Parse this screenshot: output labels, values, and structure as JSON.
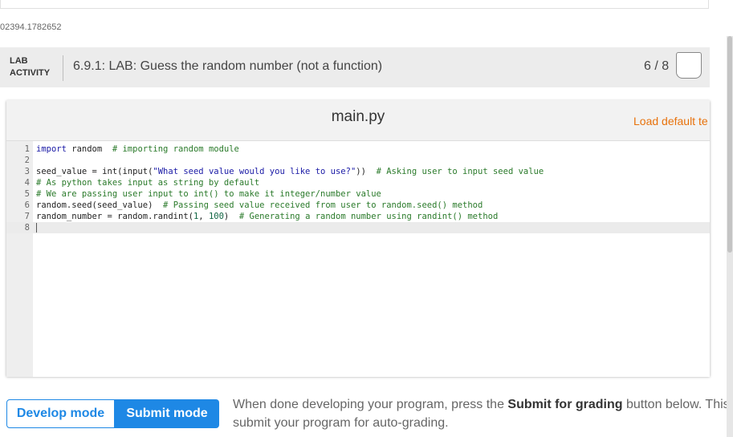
{
  "course_id": "02394.1782652",
  "lab": {
    "tag": "LAB\nACTIVITY",
    "title": "6.9.1: LAB: Guess the random number (not a function)",
    "score": "6 / 8"
  },
  "editor": {
    "filename": "main.py",
    "load_default": "Load default te",
    "lines": [
      {
        "n": "1",
        "parts": [
          {
            "t": "import",
            "c": "kw"
          },
          {
            "t": " random  ",
            "c": ""
          },
          {
            "t": "# importing random module",
            "c": "cm"
          }
        ]
      },
      {
        "n": "2",
        "parts": []
      },
      {
        "n": "3",
        "parts": [
          {
            "t": "seed_value = int(input(",
            "c": ""
          },
          {
            "t": "\"What seed value would you like to use?\"",
            "c": "str"
          },
          {
            "t": "))  ",
            "c": ""
          },
          {
            "t": "# Asking user to input seed value",
            "c": "cm"
          }
        ]
      },
      {
        "n": "4",
        "parts": [
          {
            "t": "# As python takes input as string by default",
            "c": "cm"
          }
        ]
      },
      {
        "n": "5",
        "parts": [
          {
            "t": "# We are passing user input to int() to make it integer/number value",
            "c": "cm"
          }
        ]
      },
      {
        "n": "6",
        "parts": [
          {
            "t": "random.seed(seed_value)  ",
            "c": ""
          },
          {
            "t": "# Passing seed value received from user to random.seed() method",
            "c": "cm"
          }
        ]
      },
      {
        "n": "7",
        "parts": [
          {
            "t": "random_number = random.randint(",
            "c": ""
          },
          {
            "t": "1",
            "c": "num"
          },
          {
            "t": ", ",
            "c": ""
          },
          {
            "t": "100",
            "c": "num"
          },
          {
            "t": ")  ",
            "c": ""
          },
          {
            "t": "# Generating a random number using randint() method",
            "c": "cm"
          }
        ]
      },
      {
        "n": "8",
        "parts": [],
        "active": true
      }
    ]
  },
  "modes": {
    "develop": "Develop mode",
    "submit": "Submit mode"
  },
  "info": {
    "pre": "When done developing your program, press the ",
    "bold": "Submit for grading",
    "post": " button below. This",
    "line2": "submit your program for auto-grading."
  }
}
